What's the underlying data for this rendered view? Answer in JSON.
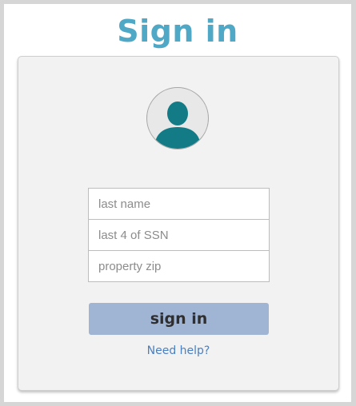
{
  "header": {
    "title": "Sign in"
  },
  "form": {
    "avatar_icon": "user-silhouette-icon",
    "fields": [
      {
        "name": "last-name",
        "placeholder": "last name",
        "value": ""
      },
      {
        "name": "last-4-ssn",
        "placeholder": "last 4 of SSN",
        "value": ""
      },
      {
        "name": "property-zip",
        "placeholder": "property zip",
        "value": ""
      }
    ],
    "submit_label": "sign in",
    "help_link": "Need help?"
  },
  "colors": {
    "title": "#4fa8c6",
    "avatar": "#137b86",
    "button": "#a0b4d4",
    "link": "#4a7fc1"
  }
}
